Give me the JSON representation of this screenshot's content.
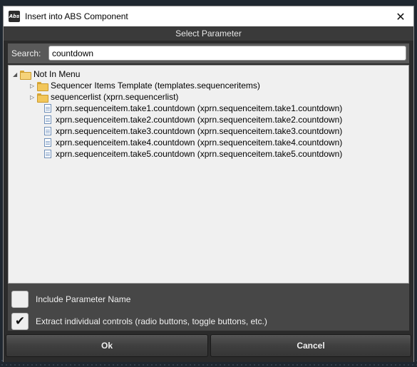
{
  "window": {
    "title": "Insert into ABS Component",
    "close_glyph": "✕"
  },
  "header": {
    "title": "Select Parameter"
  },
  "search": {
    "label": "Search:",
    "value": "countdown"
  },
  "tree": {
    "root": {
      "label": "Not In Menu",
      "expanded": true
    },
    "folders": [
      {
        "label": "Sequencer Items Template (templates.sequenceritems)"
      },
      {
        "label": "sequencerlist (xprn.sequencerlist)"
      }
    ],
    "items": [
      {
        "label": "xprn.sequenceitem.take1.countdown (xprn.sequenceitem.take1.countdown)"
      },
      {
        "label": "xprn.sequenceitem.take2.countdown (xprn.sequenceitem.take2.countdown)"
      },
      {
        "label": "xprn.sequenceitem.take3.countdown (xprn.sequenceitem.take3.countdown)"
      },
      {
        "label": "xprn.sequenceitem.take4.countdown (xprn.sequenceitem.take4.countdown)"
      },
      {
        "label": "xprn.sequenceitem.take5.countdown (xprn.sequenceitem.take5.countdown)"
      }
    ]
  },
  "options": {
    "include_name": {
      "label": "Include Parameter Name",
      "checked": false
    },
    "extract_controls": {
      "label": "Extract individual controls (radio buttons, toggle buttons, etc.)",
      "checked": true,
      "check_glyph": "✔"
    }
  },
  "buttons": {
    "ok": "Ok",
    "cancel": "Cancel"
  },
  "icons": {
    "app": "abs-app-icon",
    "folder": "folder-icon",
    "file": "document-icon"
  }
}
